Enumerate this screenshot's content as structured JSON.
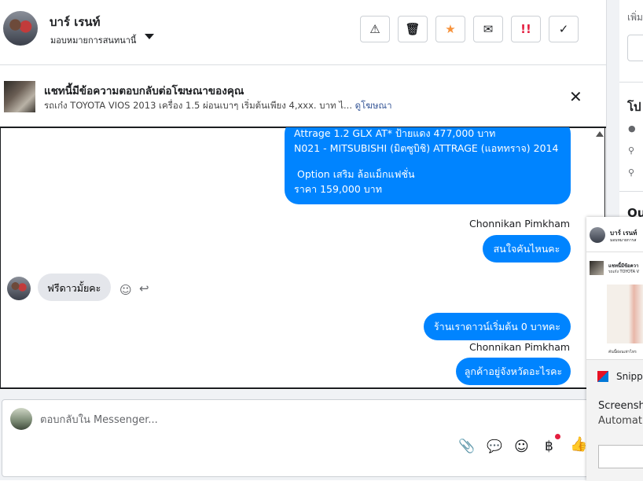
{
  "header": {
    "contact_name": "บาร์ เรนท์",
    "assign_label": "มอบหมายการสนทนานี้",
    "tools": [
      {
        "icon": "warning-icon",
        "glyph": "⚠",
        "color": "#1c1e21"
      },
      {
        "icon": "trash-icon",
        "glyph": "🗑",
        "color": "#1c1e21"
      },
      {
        "icon": "star-icon",
        "glyph": "★",
        "color": "#f7923b"
      },
      {
        "icon": "mail-open-icon",
        "glyph": "✉",
        "color": "#1c1e21"
      },
      {
        "icon": "priority-icon",
        "glyph": "!!",
        "color": "#e41e3f"
      },
      {
        "icon": "check-icon",
        "glyph": "✓",
        "color": "#1c1e21"
      }
    ]
  },
  "ad": {
    "title": "แชทนี้มีข้อความตอบกลับต่อโฆษณาของคุณ",
    "subtitle": "รถเก๋ง TOYOTA VIOS 2013 เครื่อง 1.5 ผ่อนเบาๆ เริ่มต้นเพียง 4,xxx. บาท ไ...",
    "link": "ดูโฆษณา",
    "close": "✕"
  },
  "messages": {
    "m1_line1": "Attrage 1.2 GLX AT* ป้ายแดง 477,000 บาท",
    "m1_line2": "N021 - MITSUBISHI (มิตซูบิชิ) ATTRAGE (แอททราจ) 2014",
    "m1_line3": "Option เสริม ล้อแม็กแฟชั่น",
    "m1_line4": "ราคา 159,000 บาท",
    "sender1": "Chonnikan Pimkham",
    "m2": "สนใจคันไหนคะ",
    "m3": "ฟรีดาวมั้ยคะ",
    "m4": "ร้านเราดาวน์เริ่มต้น 0 บาทคะ",
    "sender2": "Chonnikan Pimkham",
    "m5": "ลูกค้าอยู่จังหวัดอะไรคะ"
  },
  "reply": {
    "placeholder": "ตอบกลับใน Messenger..."
  },
  "sidebar": {
    "add_label": "เพิ่ม",
    "profile_label": "โป",
    "other_label": "Ou"
  },
  "floating": {
    "name": "บาร์ เรนท์",
    "sub": "มอบหมายการส",
    "ad_title": "แชทนี้มีข้อควา",
    "ad_sub": "รถเก๋ง TOYOTA V",
    "caption": "คันนี้ผ่อนเท่าไหร"
  },
  "snip": {
    "app": "Snipp",
    "line1": "Screensho",
    "line2": "Automati"
  }
}
